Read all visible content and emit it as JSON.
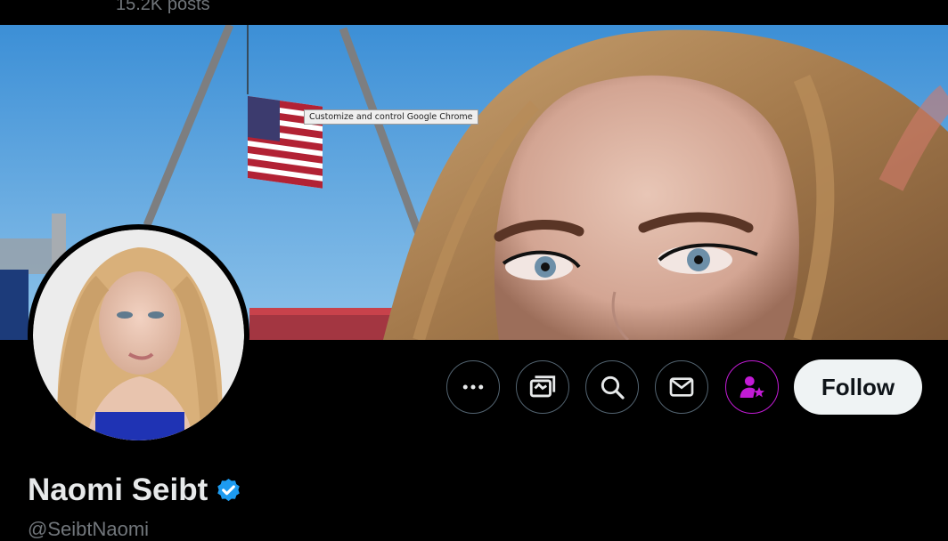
{
  "header": {
    "posts_count": "15.2K posts"
  },
  "tooltip": {
    "text": "Customize and control Google Chrome"
  },
  "profile": {
    "display_name": "Naomi Seibt",
    "handle": "@SeibtNaomi",
    "verified": true
  },
  "actions": {
    "more_icon": "more-dots-icon",
    "grok_icon": "grok-media-icon",
    "search_icon": "search-icon",
    "message_icon": "envelope-icon",
    "subscribe_icon": "person-star-icon",
    "follow_label": "Follow"
  },
  "colors": {
    "background": "#000000",
    "subscribe_accent": "#c21bd5",
    "verified_blue": "#1d9bf0",
    "follow_bg": "#eff3f4"
  }
}
